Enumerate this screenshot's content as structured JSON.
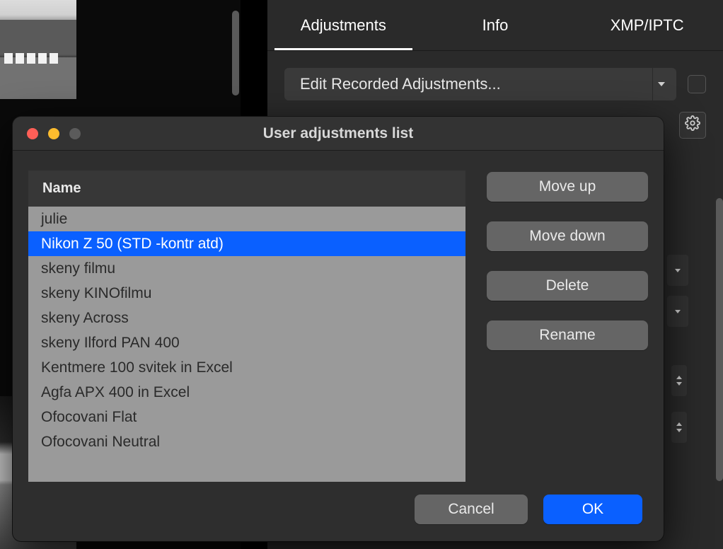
{
  "tabs": {
    "adjustments": "Adjustments",
    "info": "Info",
    "xmp": "XMP/IPTC"
  },
  "dropdown": {
    "label": "Edit Recorded Adjustments..."
  },
  "dialog": {
    "title": "User adjustments list",
    "list_header": "Name",
    "items": [
      "julie",
      "Nikon Z 50 (STD -kontr atd)",
      "skeny filmu",
      "skeny KINOfilmu",
      "skeny Across",
      "skeny Ilford PAN 400",
      "Kentmere 100 svitek in Excel",
      "Agfa APX 400 in Excel",
      "Ofocovani Flat",
      "Ofocovani Neutral"
    ],
    "selected_index": 1,
    "buttons": {
      "move_up": "Move up",
      "move_down": "Move down",
      "delete": "Delete",
      "rename": "Rename",
      "cancel": "Cancel",
      "ok": "OK"
    }
  }
}
